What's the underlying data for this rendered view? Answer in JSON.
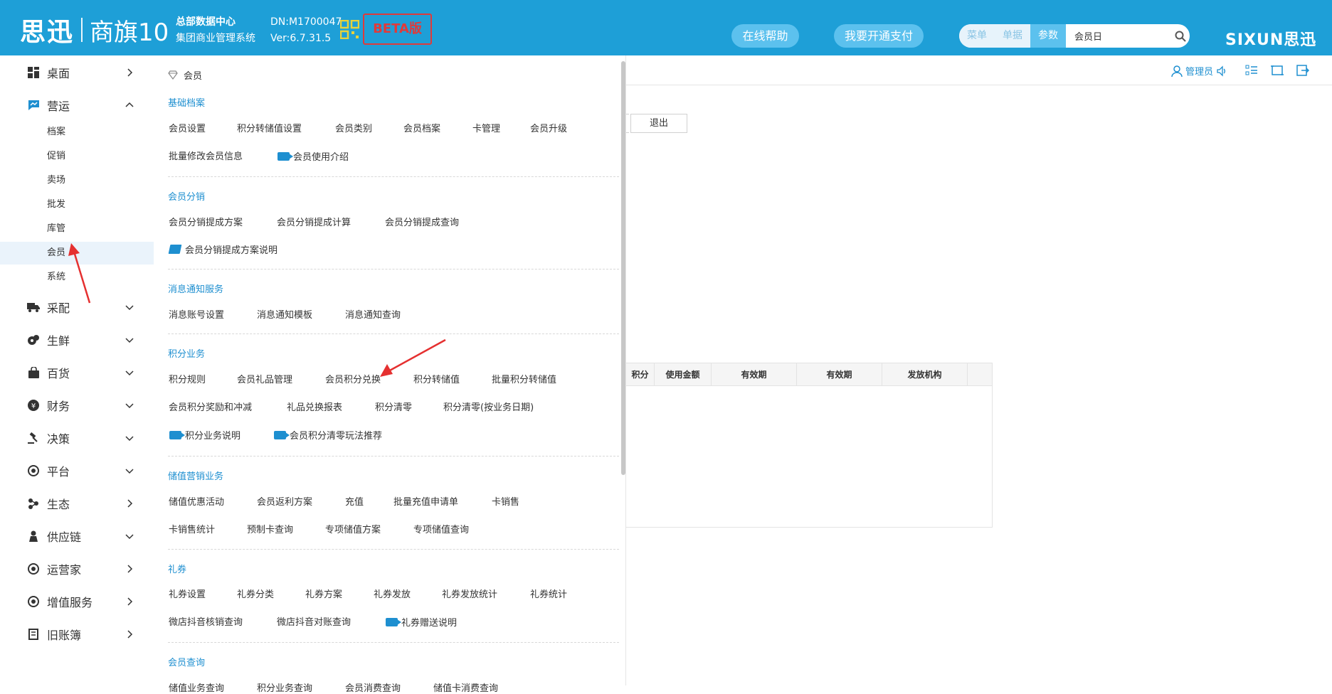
{
  "header": {
    "logo_cn": "思迅",
    "product": "商旗10",
    "org_line1": "总部数据中心",
    "org_line2": "集团商业管理系统",
    "dn": "DN:M1700047",
    "version": "Ver:6.7.31.5",
    "beta": "BETA版",
    "help_btn": "在线帮助",
    "pay_btn": "我要开通支付",
    "search_tabs": [
      "菜单",
      "单据",
      "参数"
    ],
    "search_value": "会员日",
    "brand": "SIXUN思迅",
    "accent": "#1e9fd7"
  },
  "sidebar": {
    "items": [
      {
        "label": "桌面",
        "icon": "dashboard-icon"
      },
      {
        "label": "营运",
        "icon": "flag-icon"
      },
      {
        "label": "采配",
        "icon": "truck-icon"
      },
      {
        "label": "生鲜",
        "icon": "fruit-icon"
      },
      {
        "label": "百货",
        "icon": "bag-icon"
      },
      {
        "label": "财务",
        "icon": "yen-icon"
      },
      {
        "label": "决策",
        "icon": "gavel-icon"
      },
      {
        "label": "平台",
        "icon": "target-icon"
      },
      {
        "label": "生态",
        "icon": "ecology-icon"
      },
      {
        "label": "供应链",
        "icon": "person-icon"
      },
      {
        "label": "运营家",
        "icon": "target-icon"
      },
      {
        "label": "增值服务",
        "icon": "target-icon"
      },
      {
        "label": "旧账簿",
        "icon": "ledger-icon"
      }
    ],
    "subitems": [
      "档案",
      "促销",
      "卖场",
      "批发",
      "库管",
      "会员",
      "系统"
    ]
  },
  "menu": {
    "title": "会员",
    "s1": {
      "title": "基础档案",
      "r1": [
        "会员设置",
        "积分转储值设置",
        "会员类别",
        "会员档案",
        "卡管理",
        "会员升级"
      ],
      "r2": [
        "批量修改会员信息"
      ],
      "r2v": "会员使用介绍"
    },
    "s2": {
      "title": "会员分销",
      "r1": [
        "会员分销提成方案",
        "会员分销提成计算",
        "会员分销提成查询"
      ],
      "book": "会员分销提成方案说明"
    },
    "s3": {
      "title": "消息通知服务",
      "r1": [
        "消息账号设置",
        "消息通知模板",
        "消息通知查询"
      ]
    },
    "s4": {
      "title": "积分业务",
      "r1": [
        "积分规则",
        "会员礼品管理",
        "会员积分兑换",
        "积分转储值",
        "批量积分转储值"
      ],
      "r2": [
        "会员积分奖励和冲减",
        "礼品兑换报表",
        "积分清零",
        "积分清零(按业务日期)"
      ],
      "r3v": [
        "积分业务说明",
        "会员积分清零玩法推荐"
      ]
    },
    "s5": {
      "title": "储值营销业务",
      "r1": [
        "储值优惠活动",
        "会员返利方案",
        "充值",
        "批量充值申请单",
        "卡销售"
      ],
      "r2": [
        "卡销售统计",
        "预制卡查询",
        "专项储值方案",
        "专项储值查询"
      ]
    },
    "s6": {
      "title": "礼券",
      "r1": [
        "礼券设置",
        "礼券分类",
        "礼券方案",
        "礼券发放",
        "礼券发放统计",
        "礼券统计"
      ],
      "r2": [
        "微店抖音核销查询",
        "微店抖音对账查询"
      ],
      "r2v": "礼券赠送说明"
    },
    "s7": {
      "title": "会员查询",
      "r1": [
        "储值业务查询",
        "积分业务查询",
        "会员消费查询",
        "储值卡消费查询"
      ]
    }
  },
  "content": {
    "user": "管理员",
    "exit": "退出",
    "table_headers": [
      "积分",
      "使用金额",
      "有效期",
      "有效期",
      "发放机构"
    ]
  }
}
